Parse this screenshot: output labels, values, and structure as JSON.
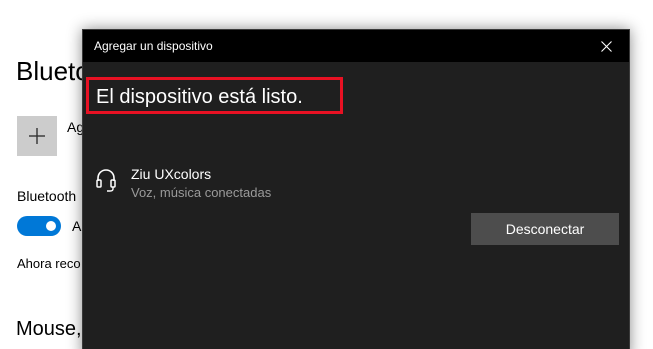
{
  "background_page": {
    "title": "Blueto",
    "add_label": "Ag",
    "bluetooth_label": "Bluetooth",
    "toggle_label": "A",
    "toggle_state": "on",
    "discover_text": "Ahora reco",
    "mouse_heading": "Mouse,"
  },
  "dialog": {
    "window_title": "Agregar un dispositivo",
    "heading": "El dispositivo está listo.",
    "device": {
      "icon": "headset-icon",
      "name": "Ziu UXcolors",
      "status": "Voz, música conectadas"
    },
    "disconnect_label": "Desconectar"
  },
  "colors": {
    "dialog_background": "#1f1f1f",
    "titlebar_background": "#000000",
    "highlight_border": "#e81123",
    "toggle_on": "#0078d7",
    "button_background": "#4d4d4d"
  }
}
